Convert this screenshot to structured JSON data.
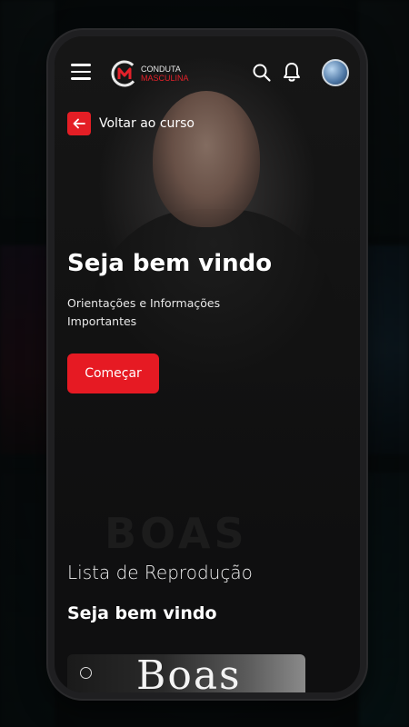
{
  "brand": {
    "line1": "CONDUTA",
    "line2": "MASCULINA",
    "accent_color": "#e41e25"
  },
  "header": {
    "menu_icon": "hamburger-menu-icon",
    "search_icon": "search-icon",
    "notifications_icon": "bell-icon",
    "avatar_icon": "user-avatar"
  },
  "back": {
    "label": "Voltar ao curso",
    "icon": "arrow-left-icon"
  },
  "hero": {
    "title": "Seja bem vindo",
    "subtitle": "Orientações e Informações Importantes",
    "cta_label": "Começar",
    "watermark": "BOAS"
  },
  "playlist": {
    "heading": "Lista de Reprodução",
    "section_title": "Seja bem vindo",
    "items": [
      {
        "thumbnail_text": "Boas"
      }
    ]
  }
}
